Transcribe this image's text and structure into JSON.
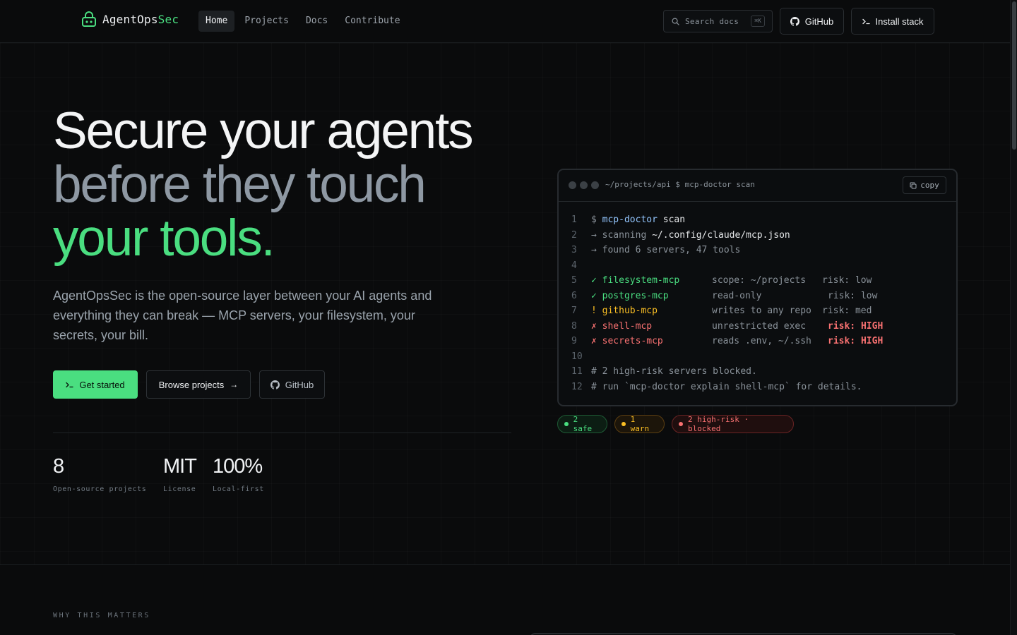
{
  "header": {
    "logo_name": "AgentOps",
    "logo_accent": "Sec",
    "nav": [
      {
        "label": "Home",
        "active": true
      },
      {
        "label": "Projects",
        "active": false
      },
      {
        "label": "Docs",
        "active": false
      },
      {
        "label": "Contribute",
        "active": false
      }
    ],
    "search_placeholder": "Search docs",
    "search_shortcut": "⌘K",
    "github_label": "GitHub",
    "install_label": "Install stack"
  },
  "hero": {
    "line1": "Secure your agents",
    "line2": "before they touch",
    "line3": "your tools.",
    "lead": "AgentOpsSec is the open-source layer between your AI agents and everything they can break — MCP servers, your filesystem, your secrets, your bill.",
    "primary_label": "Get started",
    "browse_label": "Browse projects",
    "github_label": "GitHub"
  },
  "stats": [
    {
      "value": "8",
      "label": "Open-source projects"
    },
    {
      "value": "MIT",
      "label": "License"
    },
    {
      "value": "100%",
      "label": "Local-first"
    }
  ],
  "terminal": {
    "path": "~/projects/api $ mcp-doctor scan",
    "copy_label": "copy",
    "lines": {
      "n1": "1",
      "n2": "2",
      "n3": "3",
      "n4": "4",
      "n5": "5",
      "n6": "6",
      "n7": "7",
      "n8": "8",
      "n9": "9",
      "n10": "10",
      "n11": "11",
      "n12": "12",
      "l1_prompt": "$ ",
      "l1_cmd": "mcp-doctor",
      "l1_arg": " scan",
      "l2_a": "→ scanning ",
      "l2_b": "~/.config/claude/mcp.json",
      "l3": "→ found 6 servers, 47 tools",
      "s1_mark": "✓ ",
      "s1_name": "filesystem-mcp",
      "s1_scope": "scope: ~/projects",
      "s1_risk": "risk: low",
      "s2_mark": "✓ ",
      "s2_name": "postgres-mcp",
      "s2_scope": "read-only",
      "s2_risk": "risk: low",
      "s3_mark": "! ",
      "s3_name": "github-mcp",
      "s3_scope": "writes to any repo",
      "s3_risk": "risk: med",
      "s4_mark": "✗ ",
      "s4_name": "shell-mcp",
      "s4_scope": "unrestricted exec",
      "s4_risk": "risk: HIGH",
      "s5_mark": "✗ ",
      "s5_name": "secrets-mcp",
      "s5_scope": "reads .env, ~/.ssh",
      "s5_risk": "risk: HIGH",
      "l11": "# 2 high-risk servers blocked.",
      "l12": "# run `mcp-doctor explain shell-mcp` for details."
    }
  },
  "pills": {
    "safe": "2 safe",
    "warn": "1 warn",
    "high": "2 high-risk · blocked"
  },
  "section": {
    "eyebrow": "WHY THIS MATTERS"
  },
  "colors": {
    "accent": "#4ade80",
    "warn": "#fbbf24",
    "danger": "#f87171",
    "background": "#0a0b0c"
  }
}
